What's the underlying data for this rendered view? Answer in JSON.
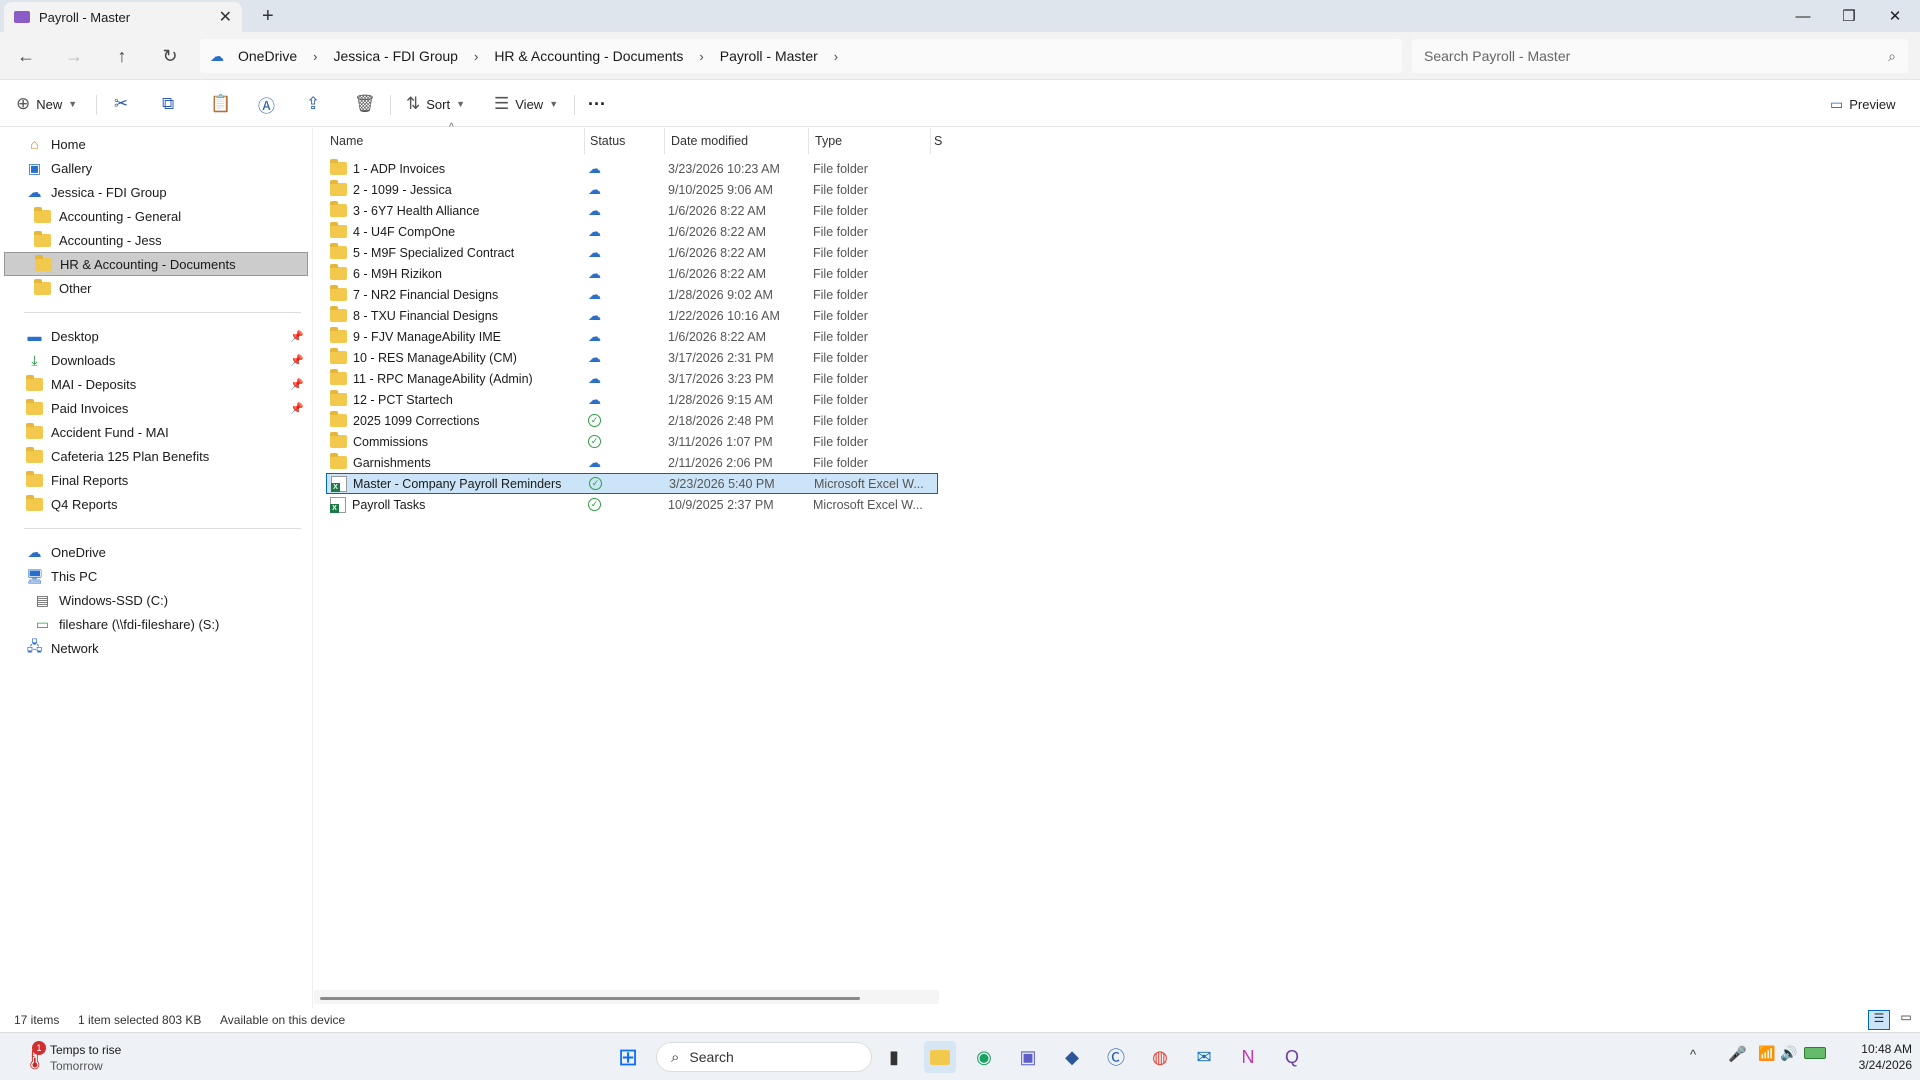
{
  "window": {
    "tab_title": "Payroll - Master",
    "new_tab": "+",
    "minimize": "—",
    "maximize": "❒",
    "close": "✕"
  },
  "address": {
    "crumbs": [
      "OneDrive",
      "Jessica - FDI Group",
      "HR & Accounting - Documents",
      "Payroll - Master"
    ],
    "search_placeholder": "Search Payroll - Master"
  },
  "toolbar": {
    "new_label": "New",
    "sort_label": "Sort",
    "view_label": "View",
    "more_label": "···",
    "preview_label": "Preview"
  },
  "sidebar": {
    "top": [
      {
        "label": "Home",
        "icon": "home-icon"
      },
      {
        "label": "Gallery",
        "icon": "gallery-icon"
      },
      {
        "label": "Jessica - FDI Group",
        "icon": "onedrive-icon"
      },
      {
        "label": "Accounting - General",
        "icon": "folder-icon"
      },
      {
        "label": "Accounting - Jess",
        "icon": "folder-icon"
      },
      {
        "label": "HR & Accounting - Documents",
        "icon": "folder-icon"
      },
      {
        "label": "Other",
        "icon": "folder-icon"
      }
    ],
    "quick": [
      {
        "label": "Desktop",
        "icon": "desktop-icon",
        "pinned": true
      },
      {
        "label": "Downloads",
        "icon": "download-icon",
        "pinned": true
      },
      {
        "label": "MAI - Deposits",
        "icon": "folder-icon",
        "pinned": true
      },
      {
        "label": "Paid Invoices",
        "icon": "folder-icon",
        "pinned": true
      },
      {
        "label": "Accident Fund - MAI",
        "icon": "folder-icon",
        "pinned": false
      },
      {
        "label": "Cafeteria 125 Plan Benefits",
        "icon": "folder-icon",
        "pinned": false
      },
      {
        "label": "Final Reports",
        "icon": "folder-icon",
        "pinned": false
      },
      {
        "label": "Q4 Reports",
        "icon": "folder-icon",
        "pinned": false
      }
    ],
    "bottom": [
      {
        "label": "OneDrive",
        "icon": "onedrive-icon"
      },
      {
        "label": "This PC",
        "icon": "pc-icon"
      },
      {
        "label": "Windows-SSD (C:)",
        "icon": "drive-icon"
      },
      {
        "label": "fileshare (\\\\fdi-fileshare) (S:)",
        "icon": "network-drive-icon"
      },
      {
        "label": "Network",
        "icon": "network-icon"
      }
    ]
  },
  "columns": {
    "name": "Name",
    "status": "Status",
    "date": "Date modified",
    "type": "Type",
    "size": "S"
  },
  "files": [
    {
      "name": "1 - ADP Invoices",
      "status": "cloud",
      "date": "3/23/2026 10:23 AM",
      "type": "File folder",
      "kind": "folder"
    },
    {
      "name": "2 - 1099 - Jessica",
      "status": "cloud",
      "date": "9/10/2025 9:06 AM",
      "type": "File folder",
      "kind": "folder"
    },
    {
      "name": "3 - 6Y7 Health Alliance",
      "status": "cloud",
      "date": "1/6/2026 8:22 AM",
      "type": "File folder",
      "kind": "folder"
    },
    {
      "name": "4 - U4F CompOne",
      "status": "cloud",
      "date": "1/6/2026 8:22 AM",
      "type": "File folder",
      "kind": "folder"
    },
    {
      "name": "5 - M9F Specialized Contract",
      "status": "cloud",
      "date": "1/6/2026 8:22 AM",
      "type": "File folder",
      "kind": "folder"
    },
    {
      "name": "6 - M9H Rizikon",
      "status": "cloud",
      "date": "1/6/2026 8:22 AM",
      "type": "File folder",
      "kind": "folder"
    },
    {
      "name": "7 - NR2 Financial Designs",
      "status": "cloud",
      "date": "1/28/2026 9:02 AM",
      "type": "File folder",
      "kind": "folder"
    },
    {
      "name": "8 - TXU Financial Designs",
      "status": "cloud",
      "date": "1/22/2026 10:16 AM",
      "type": "File folder",
      "kind": "folder"
    },
    {
      "name": "9 - FJV ManageAbility IME",
      "status": "cloud",
      "date": "1/6/2026 8:22 AM",
      "type": "File folder",
      "kind": "folder"
    },
    {
      "name": "10 - RES ManageAbility (CM)",
      "status": "cloud",
      "date": "3/17/2026 2:31 PM",
      "type": "File folder",
      "kind": "folder"
    },
    {
      "name": "11 - RPC ManageAbility (Admin)",
      "status": "cloud",
      "date": "3/17/2026 3:23 PM",
      "type": "File folder",
      "kind": "folder"
    },
    {
      "name": "12 - PCT Startech",
      "status": "cloud",
      "date": "1/28/2026 9:15 AM",
      "type": "File folder",
      "kind": "folder"
    },
    {
      "name": "2025 1099 Corrections",
      "status": "check",
      "date": "2/18/2026 2:48 PM",
      "type": "File folder",
      "kind": "folder"
    },
    {
      "name": "Commissions",
      "status": "check",
      "date": "3/11/2026 1:07 PM",
      "type": "File folder",
      "kind": "folder"
    },
    {
      "name": "Garnishments",
      "status": "cloud",
      "date": "2/11/2026 2:06 PM",
      "type": "File folder",
      "kind": "folder"
    },
    {
      "name": "Master - Company Payroll Reminders",
      "status": "check",
      "date": "3/23/2026 5:40 PM",
      "type": "Microsoft Excel W...",
      "kind": "excel",
      "selected": true
    },
    {
      "name": "Payroll Tasks",
      "status": "check",
      "date": "10/9/2025 2:37 PM",
      "type": "Microsoft Excel W...",
      "kind": "excel"
    }
  ],
  "status": {
    "count": "17 items",
    "selected": "1 item selected  803 KB",
    "availability": "Available on this device"
  },
  "taskbar": {
    "weather_title": "Temps to rise",
    "weather_sub": "Tomorrow",
    "weather_badge": "1",
    "search_label": "Search",
    "time": "10:48 AM",
    "date": "3/24/2026"
  },
  "colors": {
    "accent": "#0067c0",
    "folder": "#f2c94c",
    "sync_cloud": "#2a6fc9",
    "sync_ok": "#2f9e44"
  }
}
